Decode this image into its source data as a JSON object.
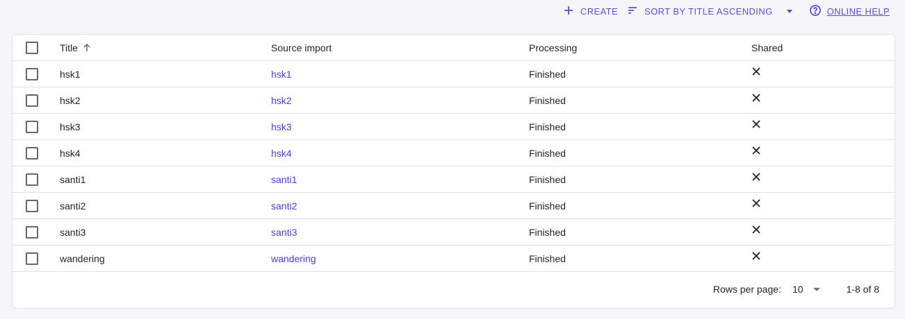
{
  "toolbar": {
    "create_label": "CREATE",
    "sort_label": "SORT BY TITLE ASCENDING",
    "help_label": "ONLINE HELP"
  },
  "table": {
    "columns": [
      "Title",
      "Source import",
      "Processing",
      "Shared"
    ],
    "rows": [
      {
        "title": "hsk1",
        "source": "hsk1",
        "processing": "Finished",
        "shared": "✕"
      },
      {
        "title": "hsk2",
        "source": "hsk2",
        "processing": "Finished",
        "shared": "✕"
      },
      {
        "title": "hsk3",
        "source": "hsk3",
        "processing": "Finished",
        "shared": "✕"
      },
      {
        "title": "hsk4",
        "source": "hsk4",
        "processing": "Finished",
        "shared": "✕"
      },
      {
        "title": "santi1",
        "source": "santi1",
        "processing": "Finished",
        "shared": "✕"
      },
      {
        "title": "santi2",
        "source": "santi2",
        "processing": "Finished",
        "shared": "✕"
      },
      {
        "title": "santi3",
        "source": "santi3",
        "processing": "Finished",
        "shared": "✕"
      },
      {
        "title": "wandering",
        "source": "wandering",
        "processing": "Finished",
        "shared": "✕"
      }
    ]
  },
  "pagination": {
    "rows_per_page_label": "Rows per page:",
    "rows_per_page_value": "10",
    "range_label": "1-8 of 8"
  },
  "colors": {
    "accent": "#5a4fcf",
    "link": "#4c3fc7",
    "background": "#f5f5fa"
  }
}
